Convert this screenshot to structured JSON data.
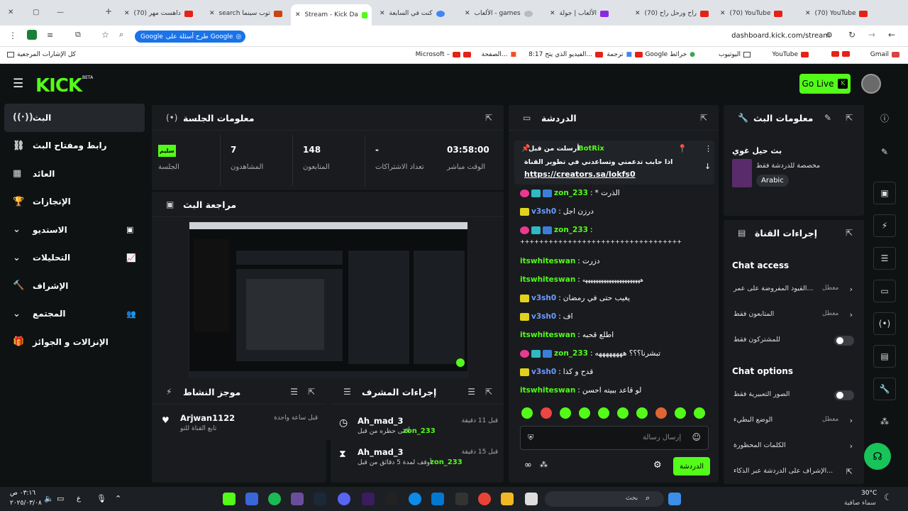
{
  "browser": {
    "tabs": [
      {
        "title": "(70) داهست مهر",
        "active": false
      },
      {
        "title": "search توب سينما",
        "active": false
      },
      {
        "title": "Stream - Kick Da",
        "active": true
      },
      {
        "title": "كنت في السابعة",
        "active": false
      },
      {
        "title": "الألعاب - games",
        "active": false
      },
      {
        "title": "الألعاب | جولة",
        "active": false
      },
      {
        "title": "(70) راح ورحل راح",
        "active": false
      },
      {
        "title": "(70) YouTube",
        "active": false
      },
      {
        "title": "(70) YouTube",
        "active": false
      }
    ],
    "url": "dashboard.kick.com/stream",
    "google_pill": "طرح أسئلة على Google",
    "bookmarks": [
      "Gmail",
      "YouTube",
      "اليوتيوب",
      "Google خرائط",
      "ترجمة",
      "8:17 الفيديو الذي يتح...",
      "الصفحة...",
      "Microsoft –",
      "كل الإشارات المرجعية"
    ]
  },
  "header": {
    "logo": "KICK",
    "beta": "BETA",
    "go_live": "Go Live"
  },
  "sidebar": {
    "items": [
      {
        "label": "البث",
        "icon": "broadcast-icon"
      },
      {
        "label": "رابط ومفتاح البث",
        "icon": "link-icon"
      },
      {
        "label": "العائد",
        "icon": "revenue-icon"
      },
      {
        "label": "الإنجازات",
        "icon": "trophy-icon"
      },
      {
        "label": "الاستديو",
        "icon": "studio-icon"
      },
      {
        "label": "التحليلات",
        "icon": "analytics-icon"
      },
      {
        "label": "الإشراف",
        "icon": "moderation-icon"
      },
      {
        "label": "المجتمع",
        "icon": "community-icon"
      },
      {
        "label": "الإنزالات و الجوائز",
        "icon": "drops-icon"
      }
    ]
  },
  "session": {
    "title": "معلومات الجلسة",
    "stats": [
      {
        "value": "03:58:00",
        "label": "الوقت مباشر"
      },
      {
        "value": "-",
        "label": "تعداد الاشتراكات"
      },
      {
        "value": "148",
        "label": "المتابعون"
      },
      {
        "value": "7",
        "label": "المشاهدون"
      },
      {
        "value": "سليم",
        "label": "الجلسة"
      }
    ]
  },
  "preview": {
    "title": "مراجعة البث"
  },
  "activity": {
    "title": "موجز النشاط",
    "user": "Arjwan1122",
    "time": "قبل ساعة واحدة",
    "action": "تابع القناة للتو"
  },
  "modactions": {
    "title": "إجراءات المشرف",
    "items": [
      {
        "user": "Ah_mad_3",
        "time": "قبل 11 دقيقة",
        "action": "ألغى حظره من قبل",
        "by": "zon_233"
      },
      {
        "user": "Ah_mad_3",
        "time": "قبل 15 دقيقة",
        "action": "أوقف لمدة 5 دقائق من قبل",
        "by": "zon_233"
      }
    ]
  },
  "chat": {
    "title": "الدردشة",
    "pinned": {
      "from": "BotRix",
      "prefix": "أرسلت من قبل",
      "text": "اذا حابب تدعمني وتساعدني في تطوير القناة",
      "link": "https://creators.sa/lokfs0"
    },
    "messages": [
      {
        "user": "zon_233",
        "text": "* الذرت",
        "color": "green"
      },
      {
        "user": "v3sh0",
        "text": "درزن اجل",
        "color": "blue"
      },
      {
        "user": "zon_233",
        "text": "",
        "color": "green"
      },
      {
        "user": "",
        "text": "++++++++++++++++++++++++++++++++++",
        "color": "text"
      },
      {
        "user": "itswhiteswan",
        "text": "دزرت",
        "color": "green"
      },
      {
        "user": "itswhiteswan",
        "text": "ههههههههههههههههههههههه",
        "color": "green"
      },
      {
        "user": "v3sh0",
        "text": "يغيب حتى في رمضان",
        "color": "blue"
      },
      {
        "user": "v3sh0",
        "text": "اف",
        "color": "blue"
      },
      {
        "user": "itswhiteswan",
        "text": "اطلع قحبه",
        "color": "green"
      },
      {
        "user": "zon_233",
        "text": "تبشرنا؟؟؟ ههههههههه",
        "color": "green"
      },
      {
        "user": "v3sh0",
        "text": "قدح و كذا",
        "color": "blue"
      },
      {
        "user": "itswhiteswan",
        "text": "لو قاعد ببيته احسن",
        "color": "green"
      }
    ],
    "input_placeholder": "إرسال رسالة",
    "send": "الدردشة"
  },
  "streaminfo": {
    "title": "معلومات البث",
    "stream_title": "بث حيل غوي",
    "category": "مخصصة للدردشة فقط",
    "language": "Arabic"
  },
  "channel": {
    "title": "إجراءات القناة",
    "access_title": "Chat access",
    "access": [
      {
        "label": "القيود المفروضة على عمر...",
        "state": "معطل"
      },
      {
        "label": "المتابعون فقط",
        "state": "معطل"
      },
      {
        "label": "للمشتركون فقط",
        "state": ""
      }
    ],
    "options_title": "Chat options",
    "options": [
      {
        "label": "الصور التعبيرية فقط",
        "state": ""
      },
      {
        "label": "الوضع البطيء",
        "state": "معطل"
      },
      {
        "label": "الكلمات المحظورة",
        "state": ""
      },
      {
        "label": "الإشراف على الدردشة عبر الذكاء...",
        "state": ""
      }
    ]
  },
  "taskbar": {
    "time": "٠٣:١٦ ص",
    "date": "٢٠٢٥/٠٣/٠٨",
    "weather": "30°C",
    "weather_desc": "سماء صافية",
    "search": "بحث"
  }
}
